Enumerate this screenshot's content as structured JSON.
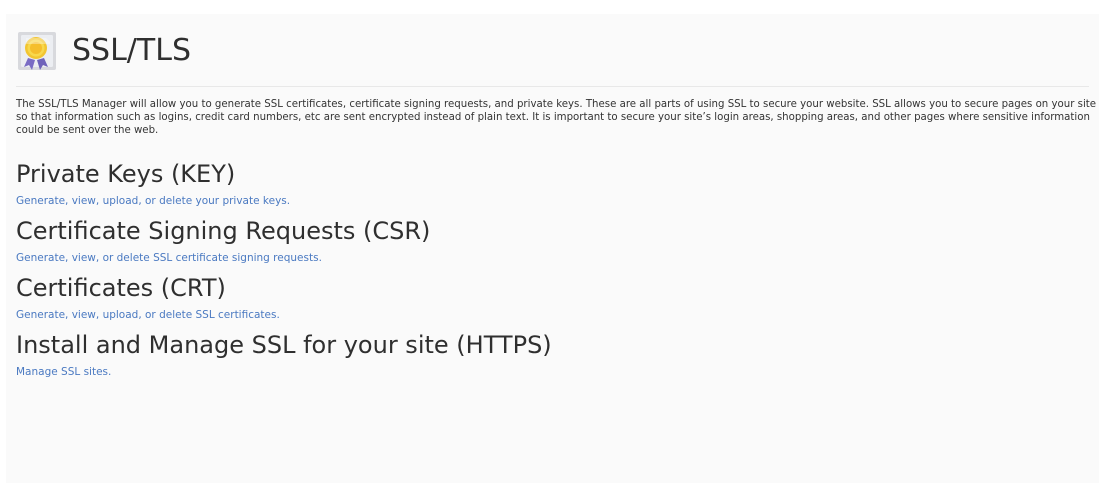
{
  "page": {
    "title": "SSL/TLS",
    "intro": "The SSL/TLS Manager will allow you to generate SSL certificates, certificate signing requests, and private keys. These are all parts of using SSL to secure your website. SSL allows you to secure pages on your site so that information such as logins, credit card numbers, etc are sent encrypted instead of plain text. It is important to secure your site’s login areas, shopping areas, and other pages where sensitive information could be sent over the web."
  },
  "sections": [
    {
      "title": "Private Keys (KEY)",
      "link": "Generate, view, upload, or delete your private keys."
    },
    {
      "title": "Certificate Signing Requests (CSR)",
      "link": "Generate, view, or delete SSL certificate signing requests."
    },
    {
      "title": "Certificates (CRT)",
      "link": "Generate, view, upload, or delete SSL certificates."
    },
    {
      "title": "Install and Manage SSL for your site (HTTPS)",
      "link": "Manage SSL sites."
    }
  ],
  "colors": {
    "link": "#4a79c1",
    "title": "#2f2f2f",
    "text": "#333333",
    "background": "#fafafa"
  },
  "icons": {
    "header": "ssl-certificate-icon"
  }
}
